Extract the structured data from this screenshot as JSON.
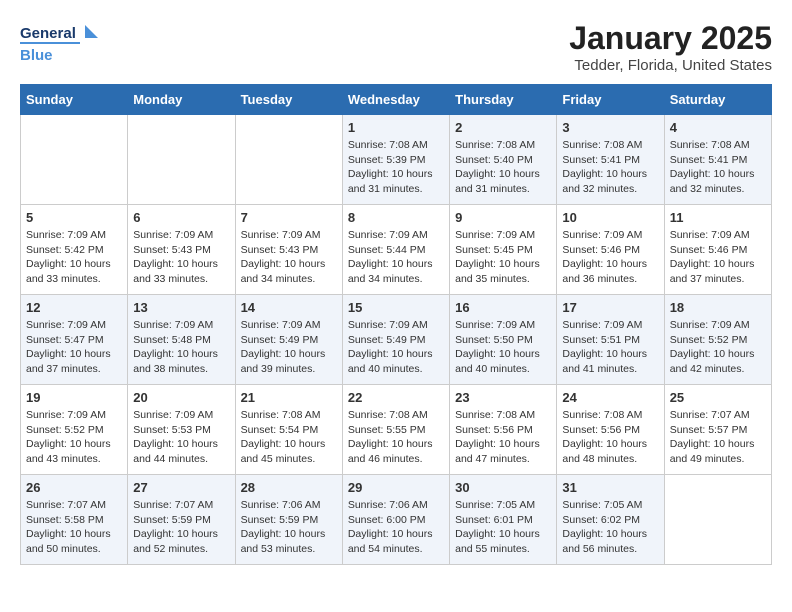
{
  "header": {
    "logo_line1": "General",
    "logo_line2": "Blue",
    "month_title": "January 2025",
    "location": "Tedder, Florida, United States"
  },
  "weekdays": [
    "Sunday",
    "Monday",
    "Tuesday",
    "Wednesday",
    "Thursday",
    "Friday",
    "Saturday"
  ],
  "weeks": [
    [
      {
        "day": "",
        "info": ""
      },
      {
        "day": "",
        "info": ""
      },
      {
        "day": "",
        "info": ""
      },
      {
        "day": "1",
        "info": "Sunrise: 7:08 AM\nSunset: 5:39 PM\nDaylight: 10 hours\nand 31 minutes."
      },
      {
        "day": "2",
        "info": "Sunrise: 7:08 AM\nSunset: 5:40 PM\nDaylight: 10 hours\nand 31 minutes."
      },
      {
        "day": "3",
        "info": "Sunrise: 7:08 AM\nSunset: 5:41 PM\nDaylight: 10 hours\nand 32 minutes."
      },
      {
        "day": "4",
        "info": "Sunrise: 7:08 AM\nSunset: 5:41 PM\nDaylight: 10 hours\nand 32 minutes."
      }
    ],
    [
      {
        "day": "5",
        "info": "Sunrise: 7:09 AM\nSunset: 5:42 PM\nDaylight: 10 hours\nand 33 minutes."
      },
      {
        "day": "6",
        "info": "Sunrise: 7:09 AM\nSunset: 5:43 PM\nDaylight: 10 hours\nand 33 minutes."
      },
      {
        "day": "7",
        "info": "Sunrise: 7:09 AM\nSunset: 5:43 PM\nDaylight: 10 hours\nand 34 minutes."
      },
      {
        "day": "8",
        "info": "Sunrise: 7:09 AM\nSunset: 5:44 PM\nDaylight: 10 hours\nand 34 minutes."
      },
      {
        "day": "9",
        "info": "Sunrise: 7:09 AM\nSunset: 5:45 PM\nDaylight: 10 hours\nand 35 minutes."
      },
      {
        "day": "10",
        "info": "Sunrise: 7:09 AM\nSunset: 5:46 PM\nDaylight: 10 hours\nand 36 minutes."
      },
      {
        "day": "11",
        "info": "Sunrise: 7:09 AM\nSunset: 5:46 PM\nDaylight: 10 hours\nand 37 minutes."
      }
    ],
    [
      {
        "day": "12",
        "info": "Sunrise: 7:09 AM\nSunset: 5:47 PM\nDaylight: 10 hours\nand 37 minutes."
      },
      {
        "day": "13",
        "info": "Sunrise: 7:09 AM\nSunset: 5:48 PM\nDaylight: 10 hours\nand 38 minutes."
      },
      {
        "day": "14",
        "info": "Sunrise: 7:09 AM\nSunset: 5:49 PM\nDaylight: 10 hours\nand 39 minutes."
      },
      {
        "day": "15",
        "info": "Sunrise: 7:09 AM\nSunset: 5:49 PM\nDaylight: 10 hours\nand 40 minutes."
      },
      {
        "day": "16",
        "info": "Sunrise: 7:09 AM\nSunset: 5:50 PM\nDaylight: 10 hours\nand 40 minutes."
      },
      {
        "day": "17",
        "info": "Sunrise: 7:09 AM\nSunset: 5:51 PM\nDaylight: 10 hours\nand 41 minutes."
      },
      {
        "day": "18",
        "info": "Sunrise: 7:09 AM\nSunset: 5:52 PM\nDaylight: 10 hours\nand 42 minutes."
      }
    ],
    [
      {
        "day": "19",
        "info": "Sunrise: 7:09 AM\nSunset: 5:52 PM\nDaylight: 10 hours\nand 43 minutes."
      },
      {
        "day": "20",
        "info": "Sunrise: 7:09 AM\nSunset: 5:53 PM\nDaylight: 10 hours\nand 44 minutes."
      },
      {
        "day": "21",
        "info": "Sunrise: 7:08 AM\nSunset: 5:54 PM\nDaylight: 10 hours\nand 45 minutes."
      },
      {
        "day": "22",
        "info": "Sunrise: 7:08 AM\nSunset: 5:55 PM\nDaylight: 10 hours\nand 46 minutes."
      },
      {
        "day": "23",
        "info": "Sunrise: 7:08 AM\nSunset: 5:56 PM\nDaylight: 10 hours\nand 47 minutes."
      },
      {
        "day": "24",
        "info": "Sunrise: 7:08 AM\nSunset: 5:56 PM\nDaylight: 10 hours\nand 48 minutes."
      },
      {
        "day": "25",
        "info": "Sunrise: 7:07 AM\nSunset: 5:57 PM\nDaylight: 10 hours\nand 49 minutes."
      }
    ],
    [
      {
        "day": "26",
        "info": "Sunrise: 7:07 AM\nSunset: 5:58 PM\nDaylight: 10 hours\nand 50 minutes."
      },
      {
        "day": "27",
        "info": "Sunrise: 7:07 AM\nSunset: 5:59 PM\nDaylight: 10 hours\nand 52 minutes."
      },
      {
        "day": "28",
        "info": "Sunrise: 7:06 AM\nSunset: 5:59 PM\nDaylight: 10 hours\nand 53 minutes."
      },
      {
        "day": "29",
        "info": "Sunrise: 7:06 AM\nSunset: 6:00 PM\nDaylight: 10 hours\nand 54 minutes."
      },
      {
        "day": "30",
        "info": "Sunrise: 7:05 AM\nSunset: 6:01 PM\nDaylight: 10 hours\nand 55 minutes."
      },
      {
        "day": "31",
        "info": "Sunrise: 7:05 AM\nSunset: 6:02 PM\nDaylight: 10 hours\nand 56 minutes."
      },
      {
        "day": "",
        "info": ""
      }
    ]
  ]
}
